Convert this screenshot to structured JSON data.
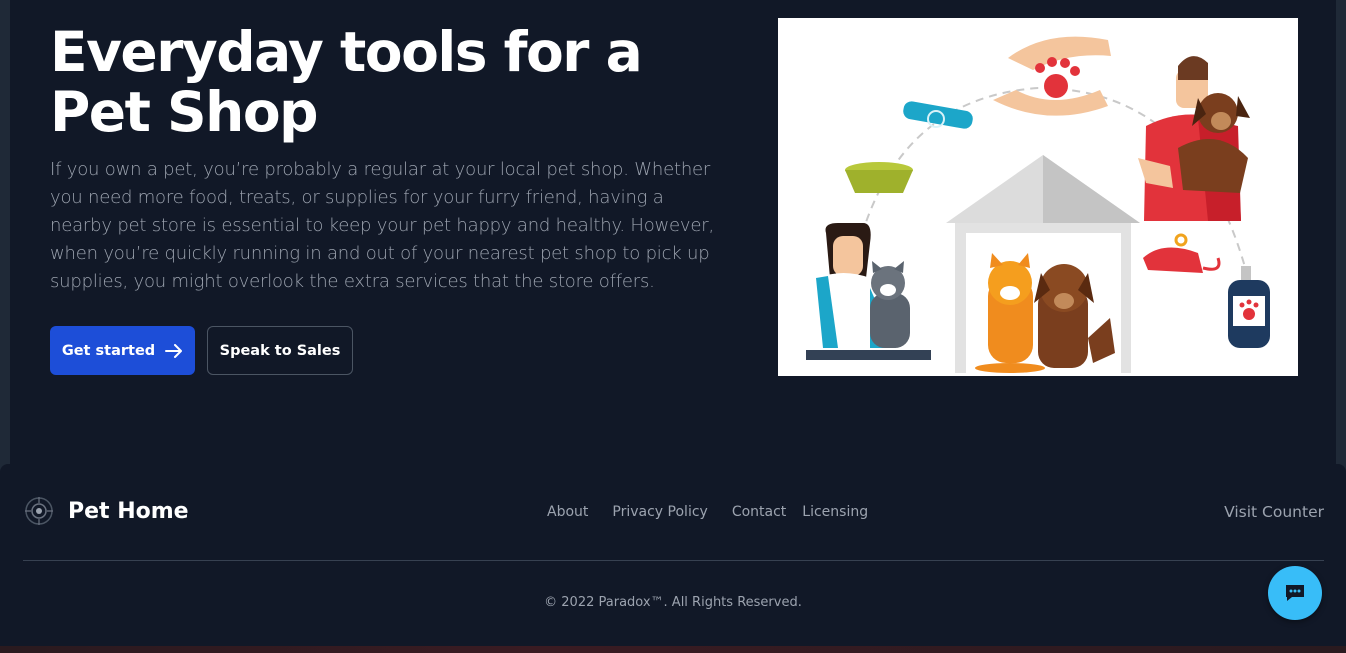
{
  "hero": {
    "title": "Everyday tools for a Pet Shop",
    "description": "If you own a pet, you’re probably a regular at your local pet shop. Whether you need more food, treats, or supplies for your furry friend, having a nearby pet store is essential to keep your pet happy and healthy. However, when you’re quickly running in and out of your nearest pet shop to pick up supplies, you might overlook the extra services that the store offers.",
    "primary_button": "Get started",
    "secondary_button": "Speak to Sales"
  },
  "footer": {
    "brand": "Pet Home",
    "links": [
      "About",
      "Privacy Policy",
      "Contact",
      "Licensing"
    ],
    "visit_counter": "Visit Counter",
    "copyright": "© 2022 Paradox™. All Rights Reserved."
  },
  "colors": {
    "background": "#111827",
    "primary": "#1d4ed8",
    "chat": "#38bdf8"
  },
  "icons": [
    "arrow-right-icon",
    "pet-home-logo-icon",
    "chat-icon"
  ]
}
